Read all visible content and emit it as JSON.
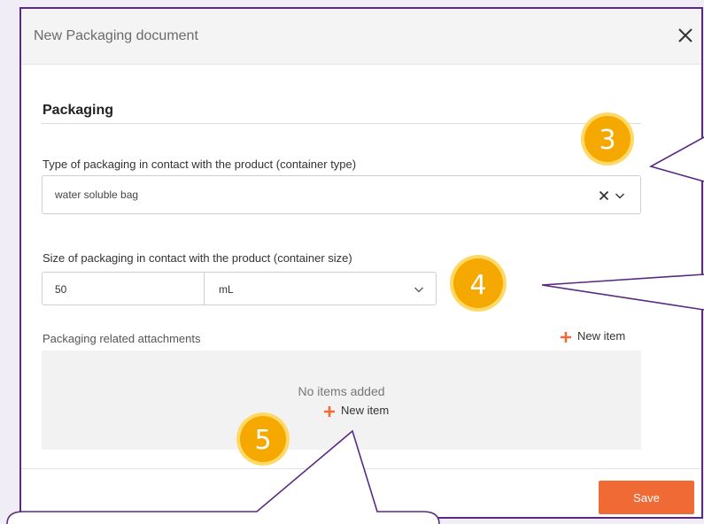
{
  "dialog": {
    "title": "New Packaging document",
    "section_title": "Packaging",
    "container_type": {
      "label": "Type of packaging in contact with the product (container type)",
      "value": "water soluble bag"
    },
    "container_size": {
      "label": "Size of packaging in contact with the product (container size)",
      "value": "50",
      "unit": "mL"
    },
    "attachments": {
      "label": "Packaging related attachments",
      "new_item_label": "New item",
      "empty_text": "No items added",
      "empty_new_item_label": "New item"
    },
    "save_label": "Save"
  },
  "callouts": {
    "badge_3": "3",
    "badge_4": "4",
    "badge_5": "5"
  },
  "colors": {
    "accent": "#f06a35",
    "frame": "#5a2a82",
    "badge_fill": "#f5a800",
    "badge_ring": "#ffd966"
  },
  "icons": [
    "close-icon",
    "clear-icon",
    "chevron-down-icon",
    "plus-icon"
  ]
}
